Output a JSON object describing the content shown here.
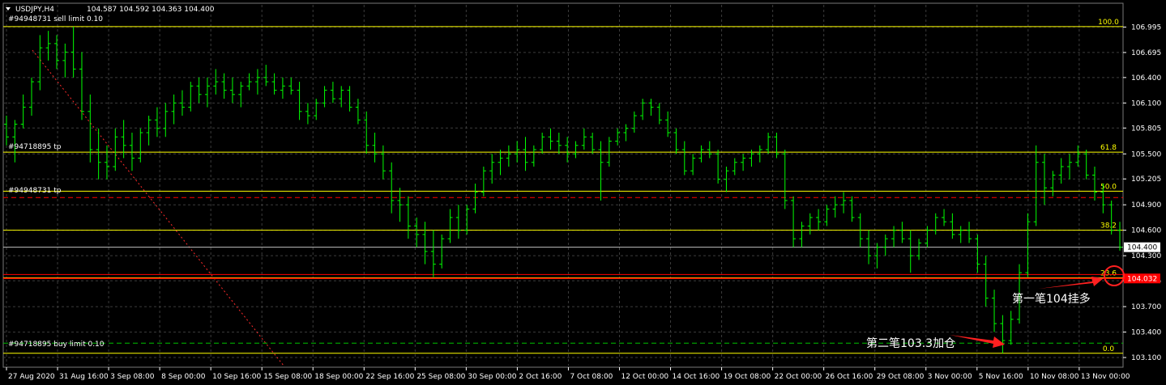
{
  "header": {
    "symbol_label": "USDJPY,H4",
    "ohlc_label": "104.587 104.592 104.363 104.400",
    "order_sell_limit": "#94948731 sell limit 0.10"
  },
  "order_labels": {
    "tp_1": "#94718895 tp",
    "tp_2": "#94948731 tp",
    "buy_limit": "#94718895 buy limit 0.10"
  },
  "annotations": {
    "first_entry": "第一笔104挂多",
    "second_entry": "第二笔103.3加仓"
  },
  "colors": {
    "background": "#000000",
    "candle": "#00ff00",
    "grid": "#3c3c3c",
    "fib_level": "#ffff00",
    "sell_tp_line": "#ff0000",
    "buy_limit_line": "#00c000",
    "price_marker": "#ffffff",
    "pending_price_marker": "#ff0000",
    "arrow": "#ff2020"
  },
  "chart_data": {
    "type": "candlestick",
    "symbol": "USDJPY",
    "timeframe": "H4",
    "ylim": [
      103.005,
      107.104
    ],
    "y_ticks": [
      "106.995",
      "106.695",
      "106.400",
      "106.100",
      "105.805",
      "105.500",
      "105.205",
      "104.900",
      "104.600",
      "104.300",
      "104.005",
      "103.700",
      "103.400",
      "103.100"
    ],
    "x_ticks": [
      "27 Aug 2020",
      "31 Aug 16:00",
      "3 Sep 08:00",
      "8 Sep 00:00",
      "10 Sep 16:00",
      "15 Sep 08:00",
      "18 Sep 00:00",
      "22 Sep 16:00",
      "25 Sep 08:00",
      "30 Sep 00:00",
      "2 Oct 16:00",
      "7 Oct 08:00",
      "12 Oct 00:00",
      "14 Oct 16:00",
      "19 Oct 08:00",
      "22 Oct 00:00",
      "26 Oct 16:00",
      "29 Oct 08:00",
      "3 Nov 00:00",
      "5 Nov 16:00",
      "10 Nov 08:00",
      "13 Nov 00:00"
    ],
    "current_price": "104.400",
    "pending_price": "104.032",
    "fib_levels": [
      {
        "label": "100.0",
        "price": 107.0
      },
      {
        "label": "61.8",
        "price": 105.52
      },
      {
        "label": "50.0",
        "price": 105.06
      },
      {
        "label": "38.2",
        "price": 104.6
      },
      {
        "label": "23.6",
        "price": 104.04
      },
      {
        "label": "0.0",
        "price": 103.15
      }
    ],
    "order_lines": [
      {
        "name": "sell-tp",
        "price": 104.985,
        "style": "dashed"
      },
      {
        "name": "buy-limit",
        "price": 103.27,
        "style": "dashed"
      },
      {
        "name": "pending-entry",
        "price": 104.032,
        "style": "solid"
      }
    ],
    "candles": [
      [
        105.85,
        105.95,
        105.6,
        105.7
      ],
      [
        105.7,
        105.9,
        105.4,
        105.85
      ],
      [
        105.85,
        106.2,
        105.8,
        106.05
      ],
      [
        106.05,
        106.4,
        105.95,
        106.35
      ],
      [
        106.35,
        106.9,
        106.25,
        106.75
      ],
      [
        106.75,
        106.95,
        106.6,
        106.8
      ],
      [
        106.8,
        106.9,
        106.5,
        106.6
      ],
      [
        106.6,
        106.8,
        106.4,
        106.7
      ],
      [
        106.7,
        107.0,
        106.4,
        106.5
      ],
      [
        106.5,
        106.7,
        105.9,
        106.0
      ],
      [
        106.0,
        106.2,
        105.4,
        105.55
      ],
      [
        105.55,
        105.8,
        105.2,
        105.4
      ],
      [
        105.4,
        105.6,
        105.2,
        105.35
      ],
      [
        105.35,
        105.8,
        105.3,
        105.7
      ],
      [
        105.7,
        105.9,
        105.45,
        105.6
      ],
      [
        105.6,
        105.75,
        105.3,
        105.45
      ],
      [
        105.45,
        105.8,
        105.4,
        105.75
      ],
      [
        105.75,
        105.95,
        105.6,
        105.9
      ],
      [
        105.9,
        106.05,
        105.7,
        105.8
      ],
      [
        105.8,
        106.1,
        105.7,
        106.0
      ],
      [
        106.0,
        106.2,
        105.85,
        106.1
      ],
      [
        106.1,
        106.25,
        105.95,
        106.05
      ],
      [
        106.05,
        106.35,
        106.0,
        106.3
      ],
      [
        106.3,
        106.4,
        106.1,
        106.2
      ],
      [
        106.2,
        106.4,
        106.05,
        106.3
      ],
      [
        106.3,
        106.5,
        106.2,
        106.35
      ],
      [
        106.35,
        106.45,
        106.15,
        106.25
      ],
      [
        106.25,
        106.4,
        106.1,
        106.2
      ],
      [
        106.2,
        106.35,
        106.05,
        106.3
      ],
      [
        106.3,
        106.45,
        106.25,
        106.35
      ],
      [
        106.35,
        106.5,
        106.2,
        106.4
      ],
      [
        106.4,
        106.55,
        106.3,
        106.35
      ],
      [
        106.35,
        106.45,
        106.2,
        106.25
      ],
      [
        106.25,
        106.4,
        106.15,
        106.3
      ],
      [
        106.3,
        106.4,
        106.2,
        106.25
      ],
      [
        106.25,
        106.35,
        105.9,
        106.0
      ],
      [
        106.0,
        106.1,
        105.85,
        105.95
      ],
      [
        105.95,
        106.15,
        105.9,
        106.1
      ],
      [
        106.1,
        106.3,
        106.05,
        106.25
      ],
      [
        106.25,
        106.35,
        106.1,
        106.15
      ],
      [
        106.15,
        106.3,
        106.05,
        106.25
      ],
      [
        106.25,
        106.3,
        106.0,
        106.05
      ],
      [
        106.05,
        106.15,
        105.85,
        105.9
      ],
      [
        105.9,
        106.0,
        105.5,
        105.6
      ],
      [
        105.6,
        105.75,
        105.4,
        105.5
      ],
      [
        105.5,
        105.6,
        105.2,
        105.3
      ],
      [
        105.3,
        105.4,
        104.8,
        104.95
      ],
      [
        104.95,
        105.1,
        104.7,
        104.9
      ],
      [
        104.9,
        105.0,
        104.5,
        104.65
      ],
      [
        104.65,
        104.75,
        104.4,
        104.55
      ],
      [
        104.55,
        104.7,
        104.2,
        104.35
      ],
      [
        104.35,
        104.6,
        104.05,
        104.2
      ],
      [
        104.2,
        104.55,
        104.15,
        104.5
      ],
      [
        104.5,
        104.85,
        104.45,
        104.75
      ],
      [
        104.75,
        104.9,
        104.5,
        104.6
      ],
      [
        104.6,
        104.9,
        104.55,
        104.85
      ],
      [
        104.85,
        105.15,
        104.8,
        105.05
      ],
      [
        105.05,
        105.35,
        105.0,
        105.3
      ],
      [
        105.3,
        105.5,
        105.15,
        105.4
      ],
      [
        105.4,
        105.55,
        105.25,
        105.45
      ],
      [
        105.45,
        105.6,
        105.35,
        105.5
      ],
      [
        105.5,
        105.65,
        105.4,
        105.55
      ],
      [
        105.55,
        105.7,
        105.3,
        105.4
      ],
      [
        105.4,
        105.6,
        105.35,
        105.55
      ],
      [
        105.55,
        105.75,
        105.5,
        105.7
      ],
      [
        105.7,
        105.8,
        105.55,
        105.65
      ],
      [
        105.65,
        105.75,
        105.5,
        105.6
      ],
      [
        105.6,
        105.7,
        105.4,
        105.5
      ],
      [
        105.5,
        105.65,
        105.45,
        105.6
      ],
      [
        105.6,
        105.8,
        105.55,
        105.7
      ],
      [
        105.7,
        105.75,
        105.5,
        105.55
      ],
      [
        105.55,
        105.65,
        104.95,
        105.4
      ],
      [
        105.4,
        105.7,
        105.35,
        105.65
      ],
      [
        105.65,
        105.8,
        105.6,
        105.75
      ],
      [
        105.75,
        105.85,
        105.65,
        105.8
      ],
      [
        105.8,
        106.0,
        105.75,
        105.95
      ],
      [
        105.95,
        106.15,
        105.9,
        106.1
      ],
      [
        106.1,
        106.15,
        105.95,
        106.05
      ],
      [
        106.05,
        106.1,
        105.85,
        105.9
      ],
      [
        105.9,
        106.0,
        105.7,
        105.75
      ],
      [
        105.75,
        105.8,
        105.5,
        105.55
      ],
      [
        105.55,
        105.65,
        105.25,
        105.3
      ],
      [
        105.3,
        105.5,
        105.25,
        105.45
      ],
      [
        105.45,
        105.6,
        105.4,
        105.55
      ],
      [
        105.55,
        105.65,
        105.45,
        105.5
      ],
      [
        105.5,
        105.55,
        105.15,
        105.2
      ],
      [
        105.2,
        105.35,
        105.05,
        105.3
      ],
      [
        105.3,
        105.45,
        105.25,
        105.4
      ],
      [
        105.4,
        105.5,
        105.3,
        105.45
      ],
      [
        105.45,
        105.55,
        105.35,
        105.5
      ],
      [
        105.5,
        105.6,
        105.4,
        105.55
      ],
      [
        105.55,
        105.75,
        105.5,
        105.7
      ],
      [
        105.7,
        105.75,
        105.45,
        105.5
      ],
      [
        105.5,
        105.55,
        104.85,
        104.95
      ],
      [
        104.95,
        105.0,
        104.4,
        104.5
      ],
      [
        104.5,
        104.7,
        104.4,
        104.65
      ],
      [
        104.65,
        104.8,
        104.55,
        104.75
      ],
      [
        104.75,
        104.85,
        104.6,
        104.7
      ],
      [
        104.7,
        104.9,
        104.65,
        104.85
      ],
      [
        104.85,
        105.0,
        104.75,
        104.9
      ],
      [
        104.9,
        105.05,
        104.8,
        104.95
      ],
      [
        104.95,
        105.0,
        104.7,
        104.75
      ],
      [
        104.75,
        104.8,
        104.4,
        104.5
      ],
      [
        104.5,
        104.6,
        104.2,
        104.3
      ],
      [
        104.3,
        104.45,
        104.15,
        104.4
      ],
      [
        104.4,
        104.55,
        104.3,
        104.5
      ],
      [
        104.5,
        104.65,
        104.4,
        104.6
      ],
      [
        104.6,
        104.7,
        104.45,
        104.5
      ],
      [
        104.5,
        104.6,
        104.1,
        104.3
      ],
      [
        104.3,
        104.5,
        104.25,
        104.45
      ],
      [
        104.45,
        104.65,
        104.4,
        104.6
      ],
      [
        104.6,
        104.8,
        104.55,
        104.75
      ],
      [
        104.75,
        104.85,
        104.65,
        104.7
      ],
      [
        104.7,
        104.8,
        104.5,
        104.55
      ],
      [
        104.55,
        104.65,
        104.45,
        104.6
      ],
      [
        104.6,
        104.7,
        104.45,
        104.5
      ],
      [
        104.5,
        104.55,
        104.1,
        104.2
      ],
      [
        104.2,
        104.3,
        103.7,
        103.8
      ],
      [
        103.8,
        103.9,
        103.4,
        103.5
      ],
      [
        103.5,
        103.6,
        103.15,
        103.3
      ],
      [
        103.3,
        103.65,
        103.25,
        103.55
      ],
      [
        103.55,
        104.2,
        103.5,
        104.1
      ],
      [
        104.1,
        104.8,
        104.05,
        104.7
      ],
      [
        104.7,
        105.6,
        104.65,
        105.4
      ],
      [
        105.4,
        105.5,
        104.9,
        105.1
      ],
      [
        105.1,
        105.3,
        105.0,
        105.25
      ],
      [
        105.25,
        105.45,
        105.15,
        105.35
      ],
      [
        105.35,
        105.5,
        105.2,
        105.4
      ],
      [
        105.4,
        105.6,
        105.35,
        105.5
      ],
      [
        105.5,
        105.55,
        105.2,
        105.25
      ],
      [
        105.25,
        105.35,
        104.95,
        105.05
      ],
      [
        105.05,
        105.15,
        104.8,
        104.9
      ],
      [
        104.9,
        104.95,
        104.55,
        104.6
      ],
      [
        104.6,
        104.7,
        104.36,
        104.4
      ]
    ]
  }
}
